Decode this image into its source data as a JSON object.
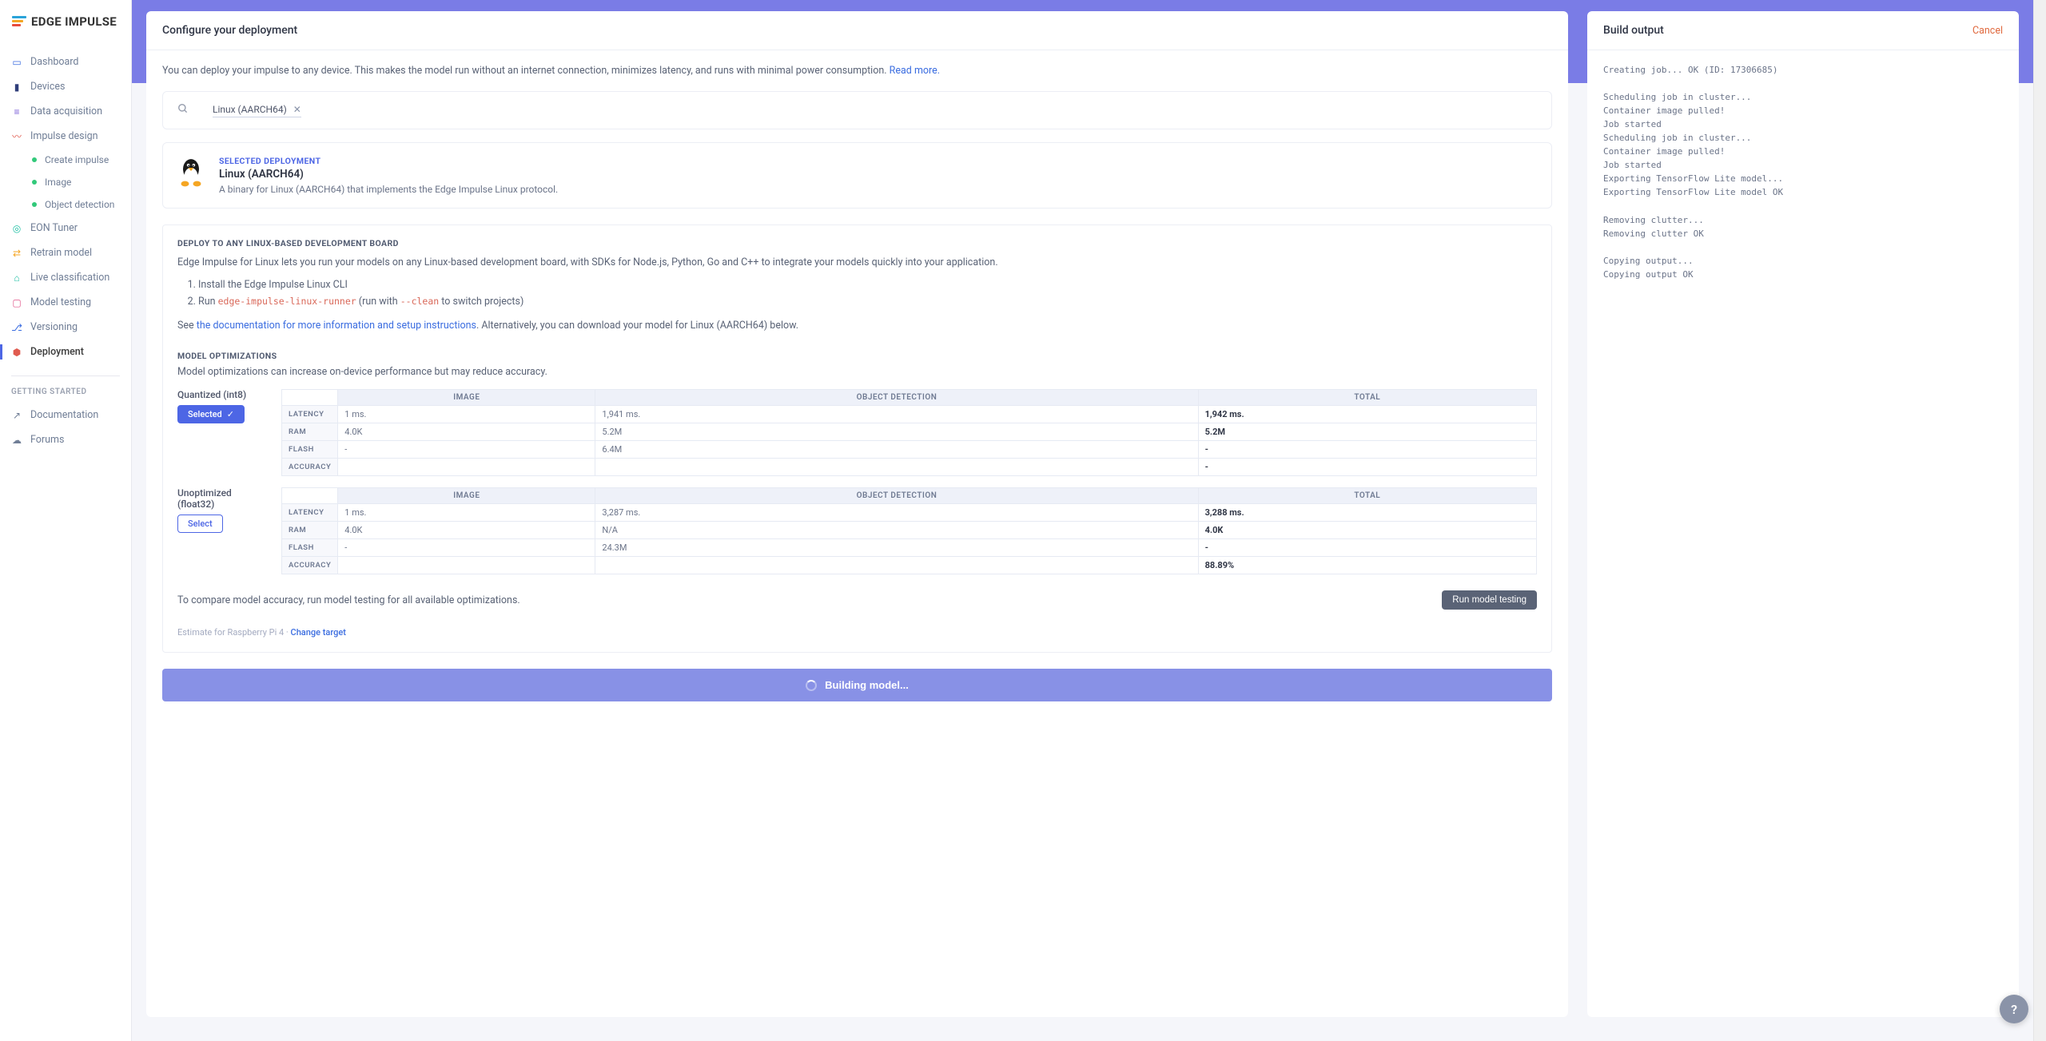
{
  "brand": "EDGE IMPULSE",
  "sidebar": {
    "items": [
      {
        "label": "Dashboard",
        "icon": "monitor-icon"
      },
      {
        "label": "Devices",
        "icon": "device-icon"
      },
      {
        "label": "Data acquisition",
        "icon": "database-icon"
      },
      {
        "label": "Impulse design",
        "icon": "pulse-icon"
      },
      {
        "label": "EON Tuner",
        "icon": "target-icon"
      },
      {
        "label": "Retrain model",
        "icon": "shuffle-icon"
      },
      {
        "label": "Live classification",
        "icon": "headphones-icon"
      },
      {
        "label": "Model testing",
        "icon": "clipboard-icon"
      },
      {
        "label": "Versioning",
        "icon": "branch-icon"
      },
      {
        "label": "Deployment",
        "icon": "package-icon"
      }
    ],
    "impulse_sub": [
      "Create impulse",
      "Image",
      "Object detection"
    ],
    "section_label": "GETTING STARTED",
    "footer": [
      "Documentation",
      "Forums"
    ]
  },
  "deploy": {
    "title": "Configure your deployment",
    "intro": "You can deploy your impulse to any device. This makes the model run without an internet connection, minimizes latency, and runs with minimal power consumption.",
    "read_more": "Read more.",
    "search_chip": "Linux (AARCH64)",
    "selected": {
      "label": "SELECTED DEPLOYMENT",
      "title": "Linux (AARCH64)",
      "desc": "A binary for Linux (AARCH64) that implements the Edge Impulse Linux protocol."
    },
    "linux": {
      "header": "DEPLOY TO ANY LINUX-BASED DEVELOPMENT BOARD",
      "text": "Edge Impulse for Linux lets you run your models on any Linux-based development board, with SDKs for Node.js, Python, Go and C++ to integrate your models quickly into your application.",
      "step1": "Install the Edge Impulse Linux CLI",
      "step2_pre": "Run ",
      "step2_code": "edge-impulse-linux-runner",
      "step2_mid": " (run with ",
      "step2_code2": "--clean",
      "step2_post": " to switch projects)",
      "see_pre": "See ",
      "see_link": "the documentation for more information and setup instructions",
      "see_post": ". Alternatively, you can download your model for Linux (AARCH64) below."
    },
    "model_opt": {
      "header": "MODEL OPTIMIZATIONS",
      "note": "Model optimizations can increase on-device performance but may reduce accuracy.",
      "columns": [
        "IMAGE",
        "OBJECT DETECTION",
        "TOTAL"
      ],
      "metrics": [
        "LATENCY",
        "RAM",
        "FLASH",
        "ACCURACY"
      ],
      "quant": {
        "title": "Quantized (int8)",
        "btn": "Selected",
        "rows": [
          [
            "1 ms.",
            "1,941 ms.",
            "1,942 ms."
          ],
          [
            "4.0K",
            "5.2M",
            "5.2M"
          ],
          [
            "-",
            "6.4M",
            "-"
          ],
          [
            "",
            "",
            "-"
          ]
        ]
      },
      "unopt": {
        "title": "Unoptimized (float32)",
        "btn": "Select",
        "rows": [
          [
            "1 ms.",
            "3,287 ms.",
            "3,288 ms."
          ],
          [
            "4.0K",
            "N/A",
            "4.0K"
          ],
          [
            "-",
            "24.3M",
            "-"
          ],
          [
            "",
            "",
            "88.89%"
          ]
        ]
      }
    },
    "compare_text": "To compare model accuracy, run model testing for all available optimizations.",
    "run_testing_btn": "Run model testing",
    "estimate_pre": "Estimate for Raspberry Pi 4 · ",
    "estimate_link": "Change target",
    "build_btn": "Building model..."
  },
  "output": {
    "title": "Build output",
    "cancel": "Cancel",
    "log": "Creating job... OK (ID: 17306685)\n\nScheduling job in cluster...\nContainer image pulled!\nJob started\nScheduling job in cluster...\nContainer image pulled!\nJob started\nExporting TensorFlow Lite model...\nExporting TensorFlow Lite model OK\n\nRemoving clutter...\nRemoving clutter OK\n\nCopying output...\nCopying output OK"
  }
}
